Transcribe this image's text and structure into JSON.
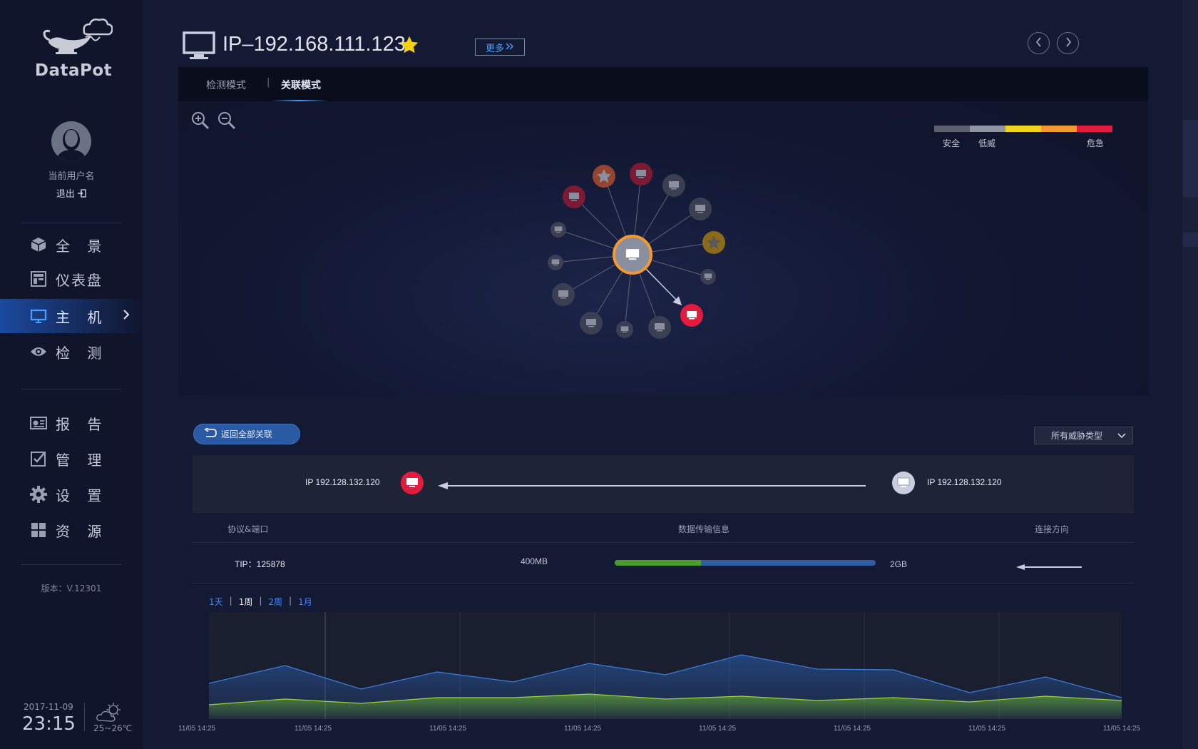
{
  "app": {
    "brand": "DataPot",
    "user": {
      "name": "当前用户名",
      "logout_label": "退出"
    },
    "version_label": "版本：V.12301",
    "date": "2017-11-09",
    "time": "23:15",
    "weather": {
      "icon": "partly-cloudy-icon",
      "temp": "25~26℃"
    }
  },
  "nav": {
    "group1": [
      {
        "label": "全 景",
        "icon": "cube-icon"
      },
      {
        "label": "仪表盘",
        "icon": "dashboard-icon"
      },
      {
        "label": "主 机",
        "icon": "monitor-icon",
        "active": true
      },
      {
        "label": "检 测",
        "icon": "eye-icon"
      }
    ],
    "group2": [
      {
        "label": "报 告",
        "icon": "report-icon"
      },
      {
        "label": "管 理",
        "icon": "checkbox-icon"
      },
      {
        "label": "设 置",
        "icon": "gear-icon"
      },
      {
        "label": "资 源",
        "icon": "grid-icon"
      }
    ]
  },
  "header": {
    "title": "IP–192.168.111.123",
    "more_label": "更多"
  },
  "graph": {
    "tabs": [
      "检测模式",
      "关联模式"
    ],
    "active_tab": 1,
    "legend": {
      "colors": [
        "#5c6070",
        "#8f93a3",
        "#f2d31b",
        "#f39a2e",
        "#e31b3c"
      ],
      "labels": [
        "安全",
        "低威",
        "危急"
      ]
    }
  },
  "detail": {
    "back_label": "返回全部关联",
    "threat_filter": "所有威胁类型",
    "connection": {
      "source_ip": "IP 192.128.132.120",
      "target_ip": "IP 192.128.132.120"
    },
    "columns": [
      "协议&端口",
      "数据传输信息",
      "连接方向"
    ],
    "row": {
      "protocol": "TIP：125878",
      "sent": "400MB",
      "total": "2GB",
      "progress_fraction": 0.33
    },
    "range_tabs": [
      "1天",
      "1周",
      "2周",
      "1月"
    ],
    "active_range": 1
  },
  "chart_data": {
    "type": "area",
    "x": [
      "11/05 14:25",
      "11/05 14:25",
      "11/05 14:25",
      "11/05 14:25",
      "11/05 14:25",
      "11/05 14:25",
      "11/05 14:25",
      "11/05 14:25",
      "11/05 14:25"
    ],
    "series": [
      {
        "values": [
          50,
          75,
          42,
          66,
          52,
          78,
          62,
          90,
          70,
          69,
          37,
          59,
          30
        ],
        "color": "#2f6fd1"
      },
      {
        "values": [
          20,
          28,
          22,
          30,
          30,
          35,
          28,
          32,
          26,
          30,
          24,
          32,
          26
        ],
        "color": "#8fd12f"
      }
    ],
    "ylim": [
      0,
      150
    ],
    "grid": "vertical"
  }
}
